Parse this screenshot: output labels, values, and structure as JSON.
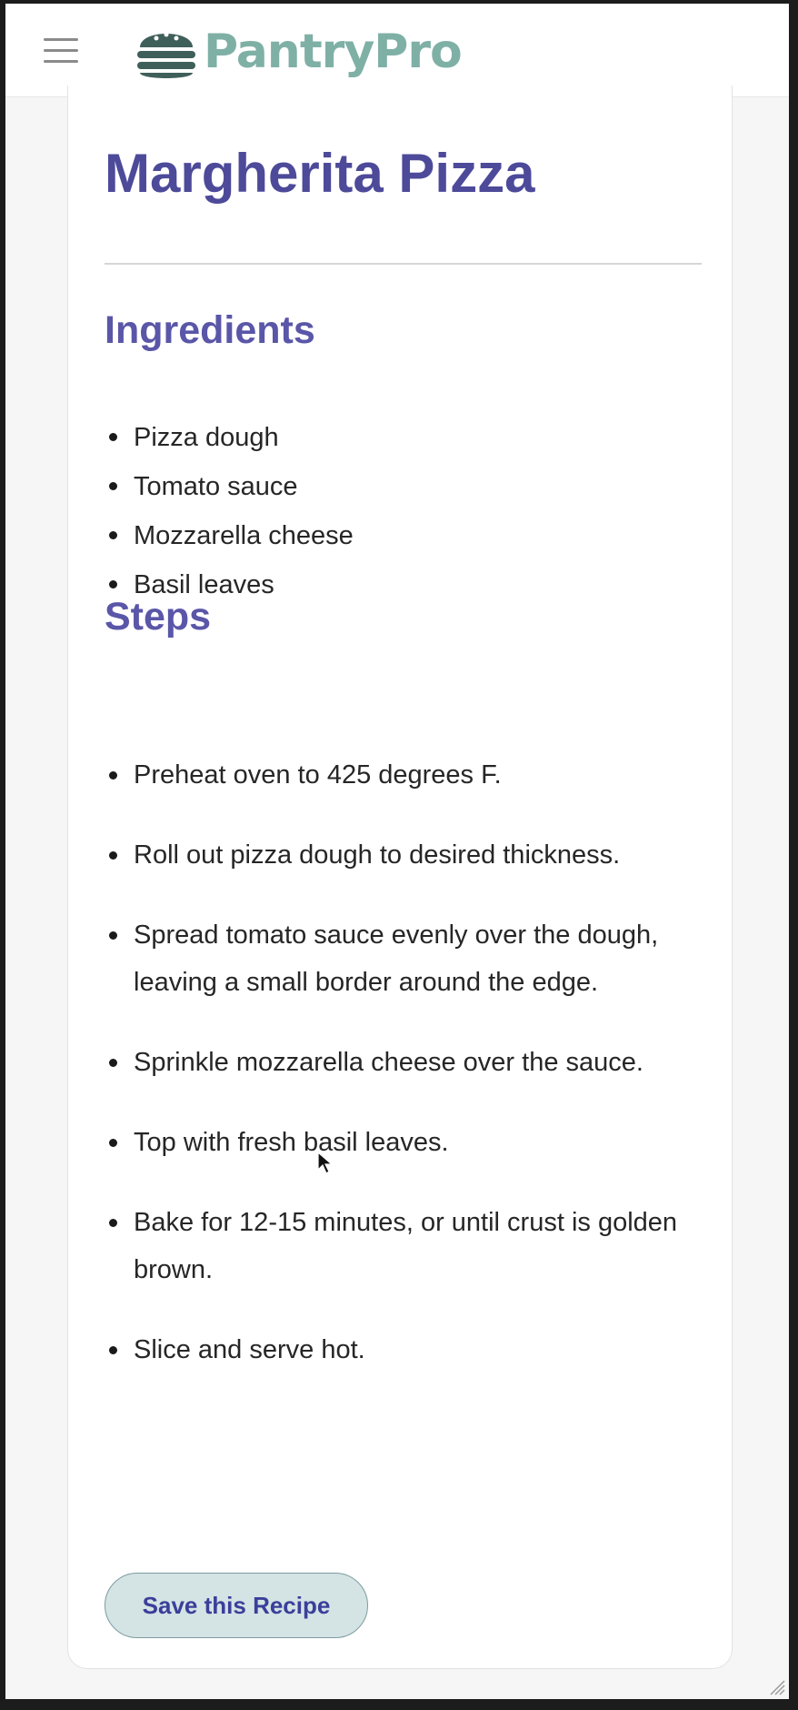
{
  "header": {
    "brand": "PantryPro",
    "menu_icon": "hamburger-menu-icon",
    "logo_icon": "burger-logo-icon",
    "brand_color": "#7fb0a6"
  },
  "recipe": {
    "title": "Margherita Pizza",
    "ingredients_heading": "Ingredients",
    "ingredients": [
      "Pizza dough",
      "Tomato sauce",
      "Mozzarella cheese",
      "Basil leaves"
    ],
    "steps_heading": "Steps",
    "steps": [
      "Preheat oven to 425 degrees F.",
      "Roll out pizza dough to desired thickness.",
      "Spread tomato sauce evenly over the dough, leaving a small border around the edge.",
      "Sprinkle mozzarella cheese over the sauce.",
      "Top with fresh basil leaves.",
      "Bake for 12-15 minutes, or until crust is golden brown.",
      "Slice and serve hot."
    ],
    "save_label": "Save this Recipe"
  },
  "colors": {
    "title": "#4d4a9a",
    "button_bg": "#d4e3e4",
    "button_text": "#3b3f9a"
  }
}
